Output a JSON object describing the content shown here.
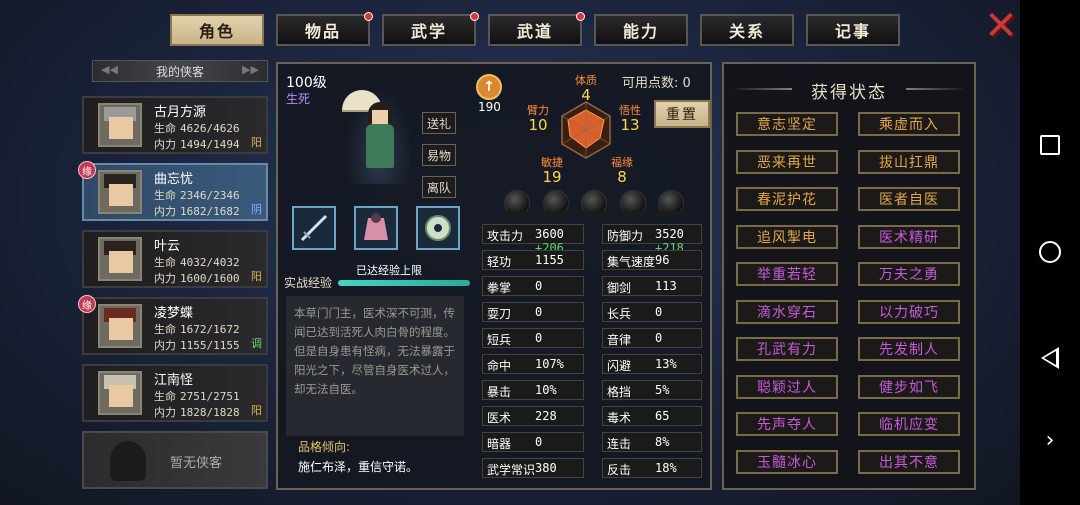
{
  "tabs": [
    {
      "label": "角色",
      "active": true,
      "alert": false
    },
    {
      "label": "物品",
      "active": false,
      "alert": true
    },
    {
      "label": "武学",
      "active": false,
      "alert": true
    },
    {
      "label": "武道",
      "active": false,
      "alert": true
    },
    {
      "label": "能力",
      "active": false,
      "alert": false
    },
    {
      "label": "关系",
      "active": false,
      "alert": false
    },
    {
      "label": "记事",
      "active": false,
      "alert": false
    }
  ],
  "close_label": "✕",
  "party": {
    "header": "我的侠客",
    "members": [
      {
        "name": "古月方源",
        "hp_label": "生命",
        "hp": "4626/4626",
        "mp_label": "内力",
        "mp": "1494/1494",
        "tag": "阳",
        "fate": false,
        "selected": false
      },
      {
        "name": "曲忘忧",
        "hp_label": "生命",
        "hp": "2346/2346",
        "mp_label": "内力",
        "mp": "1682/1682",
        "tag": "阴",
        "fate": true,
        "selected": true
      },
      {
        "name": "叶云",
        "hp_label": "生命",
        "hp": "4032/4032",
        "mp_label": "内力",
        "mp": "1600/1600",
        "tag": "阳",
        "fate": false,
        "selected": false
      },
      {
        "name": "凌梦蝶",
        "hp_label": "生命",
        "hp": "1672/1672",
        "mp_label": "内力",
        "mp": "1155/1155",
        "tag": "调",
        "fate": true,
        "selected": false
      },
      {
        "name": "江南怪",
        "hp_label": "生命",
        "hp": "2751/2751",
        "mp_label": "内力",
        "mp": "1828/1828",
        "tag": "阳",
        "fate": false,
        "selected": false
      }
    ],
    "fate_label": "缘",
    "empty_label": "暂无侠客"
  },
  "character": {
    "level": "100级",
    "sub": "生死",
    "buttons": [
      "送礼",
      "易物",
      "离队"
    ],
    "exp_label": "实战经验",
    "exp_text": "已达经验上限",
    "exp_progress": 1.0,
    "bio": "本草门门主，医术深不可测，传闻已达到活死人肉白骨的程度。但是自身患有怪病，无法暴露于阳光之下，尽管自身医术过人，却无法自医。",
    "trait_header": "品格倾向:",
    "trait": "施仁布泽，重信守诺。"
  },
  "attributes": {
    "potential": "190",
    "points_label": "可用点数:",
    "points": "0",
    "reset_label": "重置",
    "items": [
      {
        "name": "体质",
        "value": "4"
      },
      {
        "name": "悟性",
        "value": "13"
      },
      {
        "name": "福缘",
        "value": "8"
      },
      {
        "name": "敏捷",
        "value": "19"
      },
      {
        "name": "臂力",
        "value": "10"
      }
    ]
  },
  "stats": [
    {
      "k": "攻击力",
      "v": "3600",
      "bonus": "+206"
    },
    {
      "k": "防御力",
      "v": "3520",
      "bonus": "+218"
    },
    {
      "k": "轻功",
      "v": "1155",
      "bonus": ""
    },
    {
      "k": "集气速度",
      "v": "96",
      "bonus": ""
    },
    {
      "k": "拳掌",
      "v": "0",
      "bonus": ""
    },
    {
      "k": "御剑",
      "v": "113",
      "bonus": ""
    },
    {
      "k": "耍刀",
      "v": "0",
      "bonus": ""
    },
    {
      "k": "长兵",
      "v": "0",
      "bonus": ""
    },
    {
      "k": "短兵",
      "v": "0",
      "bonus": ""
    },
    {
      "k": "音律",
      "v": "0",
      "bonus": ""
    },
    {
      "k": "命中",
      "v": "107%",
      "bonus": ""
    },
    {
      "k": "闪避",
      "v": "13%",
      "bonus": ""
    },
    {
      "k": "暴击",
      "v": "10%",
      "bonus": ""
    },
    {
      "k": "格挡",
      "v": "5%",
      "bonus": ""
    },
    {
      "k": "医术",
      "v": "228",
      "bonus": ""
    },
    {
      "k": "毒术",
      "v": "65",
      "bonus": ""
    },
    {
      "k": "暗器",
      "v": "0",
      "bonus": ""
    },
    {
      "k": "连击",
      "v": "8%",
      "bonus": ""
    },
    {
      "k": "武学常识",
      "v": "380",
      "bonus": ""
    },
    {
      "k": "反击",
      "v": "18%",
      "bonus": ""
    }
  ],
  "status": {
    "title": "获得状态",
    "items": [
      {
        "label": "意志坚定",
        "color": "#e3a64a"
      },
      {
        "label": "乘虚而入",
        "color": "#e3a64a"
      },
      {
        "label": "恶来再世",
        "color": "#e3a64a"
      },
      {
        "label": "拔山扛鼎",
        "color": "#e3a64a"
      },
      {
        "label": "春泥护花",
        "color": "#e3a64a"
      },
      {
        "label": "医者自医",
        "color": "#e3a64a"
      },
      {
        "label": "追风掣电",
        "color": "#e3a64a"
      },
      {
        "label": "医术精研",
        "color": "#c65ad8"
      },
      {
        "label": "举重若轻",
        "color": "#c65ad8"
      },
      {
        "label": "万夫之勇",
        "color": "#c65ad8"
      },
      {
        "label": "滴水穿石",
        "color": "#c65ad8"
      },
      {
        "label": "以力破巧",
        "color": "#c65ad8"
      },
      {
        "label": "孔武有力",
        "color": "#c65ad8"
      },
      {
        "label": "先发制人",
        "color": "#c65ad8"
      },
      {
        "label": "聪颖过人",
        "color": "#c65ad8"
      },
      {
        "label": "健步如飞",
        "color": "#c65ad8"
      },
      {
        "label": "先声夺人",
        "color": "#c65ad8"
      },
      {
        "label": "临机应变",
        "color": "#c65ad8"
      },
      {
        "label": "玉髓冰心",
        "color": "#c65ad8"
      },
      {
        "label": "出其不意",
        "color": "#c65ad8"
      }
    ]
  },
  "system_nav": [
    "square-icon",
    "circle-icon",
    "back-triangle-icon",
    "chevron-right-icon"
  ]
}
